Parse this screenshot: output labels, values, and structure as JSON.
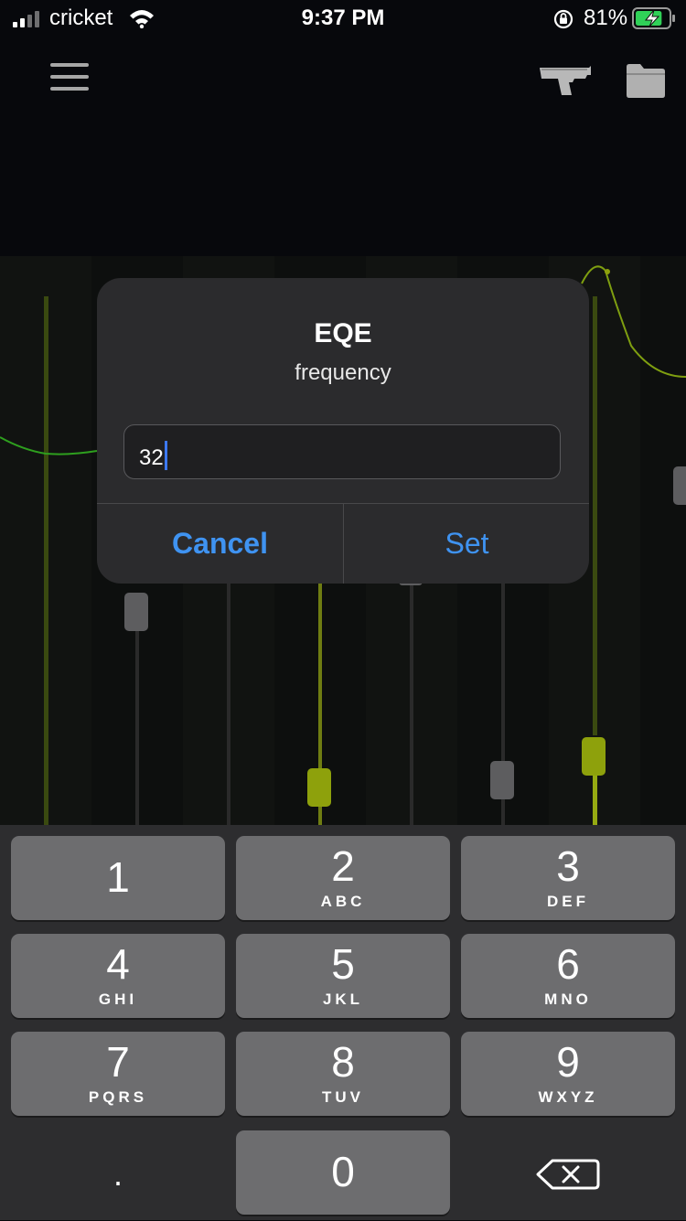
{
  "status_bar": {
    "carrier": "cricket",
    "time": "9:37 PM",
    "battery_percent": "81%",
    "battery_level": 0.81,
    "icons": [
      "signal-icon",
      "wifi-icon",
      "rotation-lock-icon",
      "battery-charging-icon"
    ]
  },
  "toolbar": {
    "icons": [
      "menu-icon",
      "pistol-icon",
      "folder-icon"
    ]
  },
  "colors": {
    "accent_blue": "#3f93f1",
    "eq_green": "#2e9f1e",
    "eq_olive": "#8ea10c",
    "dialog_bg": "#2b2b2d",
    "key_bg": "#6d6d6f"
  },
  "dialog": {
    "title": "EQE",
    "message": "frequency",
    "input_value": "32",
    "cancel_label": "Cancel",
    "set_label": "Set"
  },
  "keyboard": {
    "keys": [
      {
        "digit": "1",
        "letters": ""
      },
      {
        "digit": "2",
        "letters": "ABC"
      },
      {
        "digit": "3",
        "letters": "DEF"
      },
      {
        "digit": "4",
        "letters": "GHI"
      },
      {
        "digit": "5",
        "letters": "JKL"
      },
      {
        "digit": "6",
        "letters": "MNO"
      },
      {
        "digit": "7",
        "letters": "PQRS"
      },
      {
        "digit": "8",
        "letters": "TUV"
      },
      {
        "digit": "9",
        "letters": "WXYZ"
      },
      {
        "digit": "0",
        "letters": ""
      }
    ],
    "dot_label": ".",
    "backspace_icon": "backspace-icon"
  }
}
